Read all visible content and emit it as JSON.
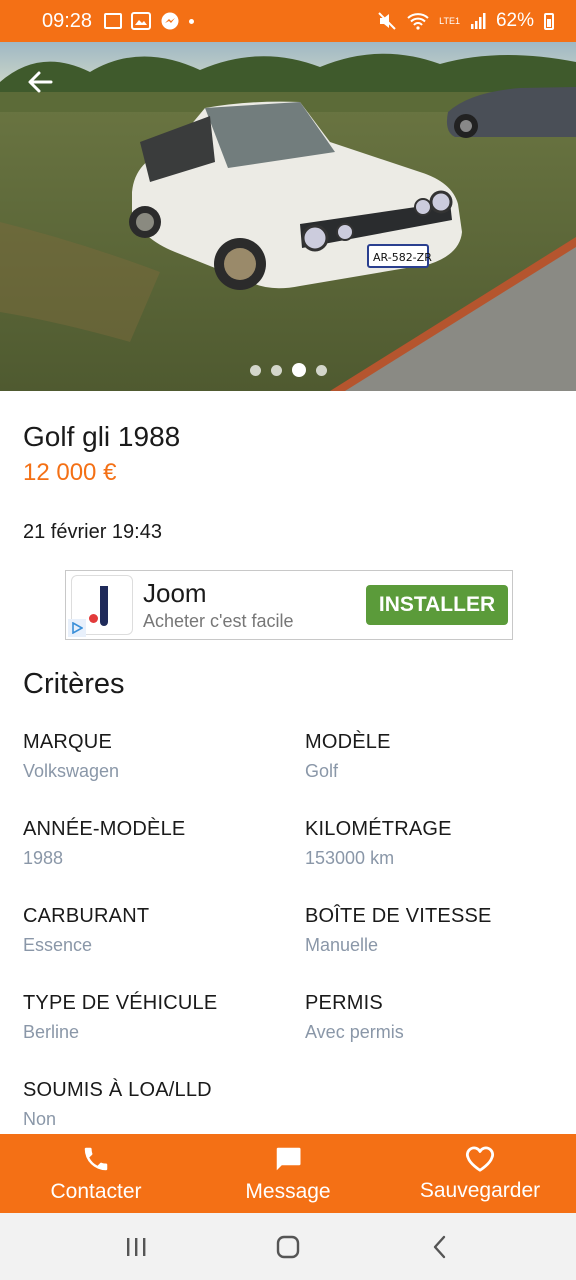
{
  "status_bar": {
    "time": "09:28",
    "battery": "62%",
    "network_label": "LTE1",
    "notification_icons": [
      "tv-icon",
      "gallery-icon",
      "messenger-icon",
      "dot-icon"
    ],
    "status_icons": [
      "mute-icon",
      "wifi-icon",
      "signal-icon",
      "battery-icon"
    ]
  },
  "gallery": {
    "image_description_icon": "car-photo",
    "license_plate": "AR-582-ZR",
    "photo_count": 4,
    "active_index": 3
  },
  "listing": {
    "title": "Golf gli 1988",
    "price": "12 000 €",
    "date": "21 février 19:43"
  },
  "ad": {
    "name": "Joom",
    "tagline": "Acheter c'est facile",
    "cta": "INSTALLER"
  },
  "criteria": {
    "heading": "Critères",
    "items": [
      {
        "label": "MARQUE",
        "value": "Volkswagen"
      },
      {
        "label": "MODÈLE",
        "value": "Golf"
      },
      {
        "label": "ANNÉE-MODÈLE",
        "value": "1988"
      },
      {
        "label": "KILOMÉTRAGE",
        "value": "153000 km"
      },
      {
        "label": "CARBURANT",
        "value": "Essence"
      },
      {
        "label": "BOÎTE DE VITESSE",
        "value": "Manuelle"
      },
      {
        "label": "TYPE DE VÉHICULE",
        "value": "Berline"
      },
      {
        "label": "PERMIS",
        "value": "Avec permis"
      },
      {
        "label": "SOUMIS À LOA/LLD",
        "value": "Non"
      }
    ]
  },
  "actions": {
    "contact": "Contacter",
    "message": "Message",
    "save": "Sauvegarder"
  },
  "colors": {
    "accent": "#f47015",
    "ad_button": "#5b9b3a",
    "value_text": "#8a97a8"
  }
}
